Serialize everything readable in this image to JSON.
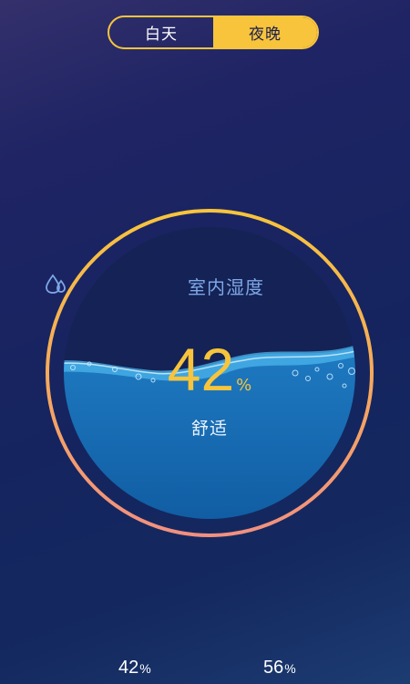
{
  "mode_toggle": {
    "options": [
      {
        "label": "白天",
        "selected": false
      },
      {
        "label": "夜晚",
        "selected": true
      }
    ]
  },
  "humidity": {
    "title": "室内湿度",
    "icon": "water-drops-icon",
    "value": "42",
    "unit": "%",
    "fill_fraction": 0.42,
    "status": "舒适"
  },
  "readings": [
    {
      "value": "42",
      "unit": "%"
    },
    {
      "value": "56",
      "unit": "%"
    }
  ],
  "colors": {
    "accent": "#f7c43c",
    "ring_bottom": "#f29080",
    "water": "#1a6fb6",
    "water_surface": "#3aa3e0",
    "label": "#7ea7e6"
  }
}
